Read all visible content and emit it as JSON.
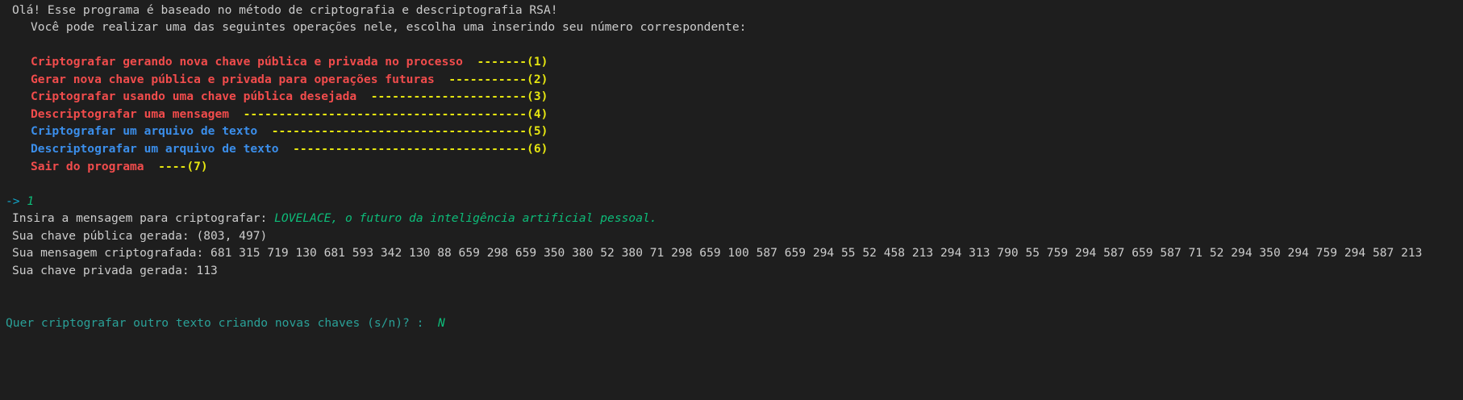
{
  "intro": {
    "greeting": "Olá! Esse programa é baseado no método de criptografia e descriptografia RSA!",
    "instructions": "Você pode realizar uma das seguintes operações nele, escolha uma inserindo seu número correspondente:"
  },
  "menu": {
    "items": [
      {
        "label": "Criptografar gerando nova chave pública e privada no processo",
        "leader": "-------(1)",
        "color": "#f14c4c"
      },
      {
        "label": "Gerar nova chave pública e privada para operações futuras",
        "leader": "-----------(2)",
        "color": "#f14c4c"
      },
      {
        "label": "Criptografar usando uma chave pública desejada",
        "leader": "----------------------(3)",
        "color": "#f14c4c"
      },
      {
        "label": "Descriptografar uma mensagem",
        "leader": "----------------------------------------(4)",
        "color": "#f14c4c"
      },
      {
        "label": "Criptografar um arquivo de texto",
        "leader": "------------------------------------(5)",
        "color": "#3b8eea"
      },
      {
        "label": "Descriptografar um arquivo de texto",
        "leader": "---------------------------------(6)",
        "color": "#3b8eea"
      },
      {
        "label": "Sair do programa",
        "leader": "----(7)",
        "color": "#f14c4c"
      }
    ],
    "leader_color": "#e5e510"
  },
  "prompt": {
    "arrow": "->",
    "choice": "1"
  },
  "output": {
    "message_prompt": "Insira a mensagem para criptografar:",
    "message_value": "LOVELACE, o futuro da inteligência artificial pessoal.",
    "public_key_label": "Sua chave pública gerada:",
    "public_key_value": "(803, 497)",
    "encrypted_label": "Sua mensagem criptografada:",
    "encrypted_value": "681 315 719 130 681 593 342 130 88 659 298 659 350 380 52 380 71 298 659 100 587 659 294 55 52 458 213 294 313 790 55 759 294 587 659 587 71 52 294 350 294 759 294 587 213",
    "private_key_label": "Sua chave privada gerada:",
    "private_key_value": "113"
  },
  "question": {
    "text": "Quer criptografar outro texto criando novas chaves (s/n)? :",
    "answer": "N"
  },
  "colors": {
    "background": "#1e1e1e",
    "default_text": "#cccccc",
    "menu_red": "#f14c4c",
    "menu_blue": "#3b8eea",
    "leader_yellow": "#e5e510",
    "prompt_teal": "#11a8cd",
    "input_green": "#0dbc79"
  }
}
